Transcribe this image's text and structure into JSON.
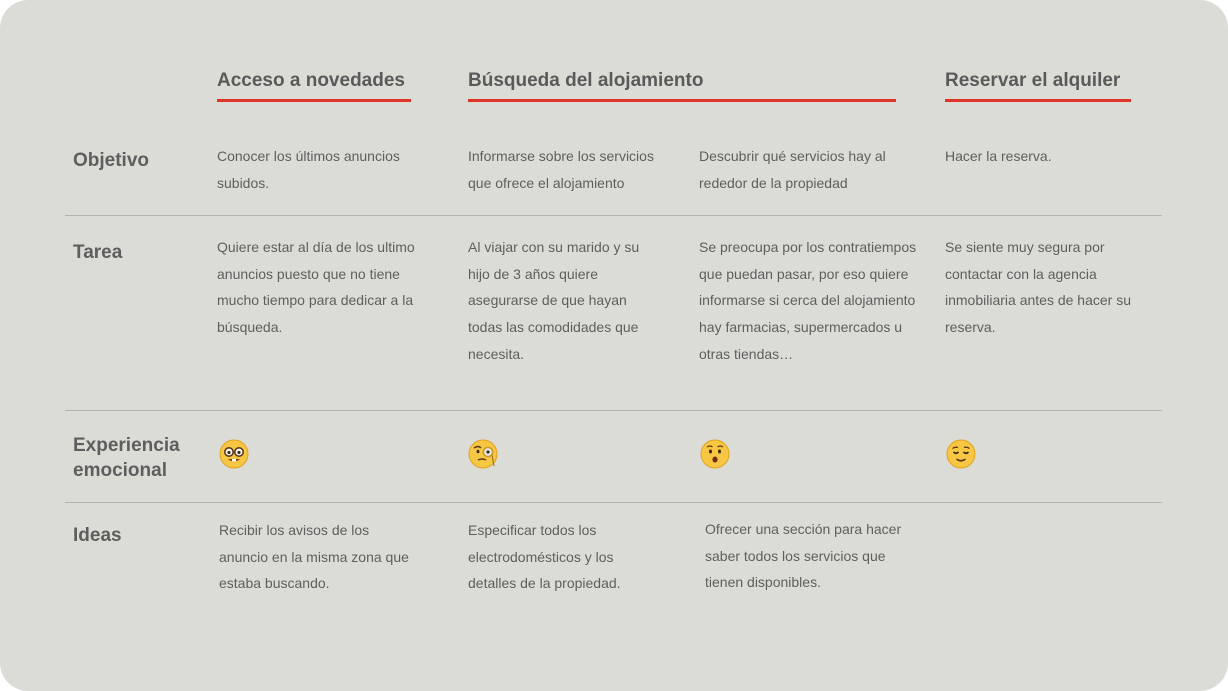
{
  "phases": {
    "p1": "Acceso a novedades",
    "p2": "Búsqueda del alojamiento",
    "p3": "Reservar el alquiler"
  },
  "rows": {
    "objetivo": {
      "label": "Objetivo",
      "c1": "Conocer los últimos anuncios subidos.",
      "c2": "Informarse sobre los servicios que ofrece el alojamiento",
      "c3": "Descubrir qué servicios hay al rededor de la propiedad",
      "c4": "Hacer la reserva."
    },
    "tarea": {
      "label": "Tarea",
      "c1": "Quiere estar al día de los ultimo anuncios puesto que no tiene mucho tiempo para dedicar a la búsqueda.",
      "c2": "Al viajar con su marido y su hijo de 3 años quiere asegurarse de que hayan todas las comodidades que necesita.",
      "c3": "Se preocupa por los contratiempos que puedan pasar, por eso quiere informarse si cerca del alojamiento hay farmacias, supermercados u otras tiendas…",
      "c4": "Se siente muy segura por contactar con la agencia inmobiliaria antes de hacer su reserva."
    },
    "experiencia": {
      "label_line1": "Experiencia",
      "label_line2": "emocional",
      "c1_icon": "nerd-face-icon",
      "c2_icon": "face-with-monocle-icon",
      "c3_icon": "hushed-face-icon",
      "c4_icon": "relieved-face-icon"
    },
    "ideas": {
      "label": "Ideas",
      "c1": "Recibir los avisos de los anuncio en la misma zona que estaba buscando.",
      "c2": "Especificar todos los electrodomésticos y los detalles de la propiedad.",
      "c3": "Ofrecer una sección para hacer saber todos los servicios que tienen disponibles."
    }
  },
  "colors": {
    "accent": "#e0362a",
    "background": "#dcdcd7",
    "text": "#5e5e5e"
  }
}
